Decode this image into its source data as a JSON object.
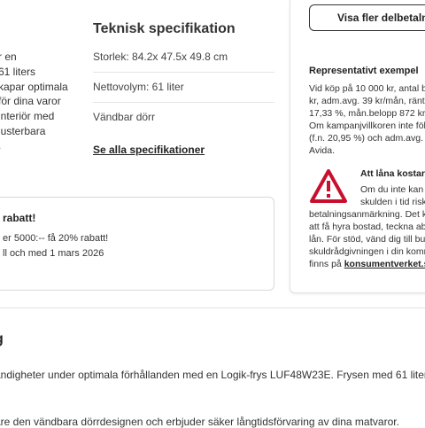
{
  "description": {
    "lines": [
      "r en",
      "61 liters",
      "kapar optimala",
      "för dina varor",
      "interiör med",
      "justerbara",
      "."
    ]
  },
  "specs": {
    "title": "Teknisk specifikation",
    "rows": [
      "Storlek: 84.2x 47.5x 49.8 cm",
      "Nettovolym: 61 liter",
      "Vändbar dörr"
    ],
    "link": "Se alla specifikationer"
  },
  "promo": {
    "title": "rabatt!",
    "lines": [
      "er 5000:-- få 20% rabatt!",
      "ll och med 1 mars 2026"
    ]
  },
  "financing": {
    "button_label": "Visa fler delbetalni",
    "rep_title": "Representativt exempel",
    "rep_lines": [
      "Vid köp på 10 000 kr, antal be",
      "kr, adm.avg. 39 kr/mån, ränta",
      "17,33 %, mån.belopp 872 kr,",
      "Om kampanjvillkoren inte föl",
      "(f.n. 20,95 %) och adm.avg. 39",
      "Avida."
    ],
    "warning": {
      "icon": "warning-triangle-icon",
      "color": "#c8102e",
      "title": "Att låna kostar p",
      "lines_beside_icon": [
        "Om du inte kan",
        "skulden i tid risk"
      ],
      "lines_full": [
        "betalningsanmärkning. Det ka",
        "att få hyra bostad, teckna abo",
        "lån. För stöd, vänd dig till bu",
        "skuldrådgivningen i din komm"
      ],
      "last_line_prefix": "finns på ",
      "link": "konsumentverket.se"
    }
  },
  "section": {
    "heading": "g",
    "lines": [
      "ändigheter under optimala förhållanden med en Logik-frys LUF48W23E. Frysen med 61 liter ar",
      "are den vändbara dörrdesignen och erbjuder säker långtidsförvaring av dina matvaror."
    ]
  }
}
